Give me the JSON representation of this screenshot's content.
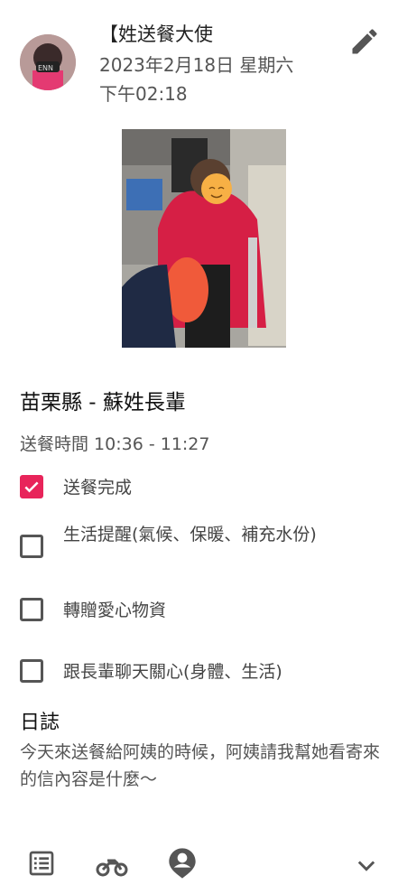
{
  "header": {
    "title": "【姓送餐大使",
    "date": "2023年2月18日 星期六",
    "time": "下午02:18"
  },
  "record": {
    "place": "苗栗縣 - 蘇姓長輩",
    "delivery_time": "送餐時間 10:36 - 11:27"
  },
  "tasks": [
    {
      "label": "送餐完成",
      "checked": true
    },
    {
      "label": "生活提醒(氣候、保暖、補充水份)",
      "checked": false
    },
    {
      "label": "轉贈愛心物資",
      "checked": false
    },
    {
      "label": "跟長輩聊天關心(身體、生活)",
      "checked": false
    }
  ],
  "log": {
    "title": "日誌",
    "body": "今天來送餐給阿姨的時候，阿姨請我幫她看寄來的信內容是什麼～"
  },
  "colors": {
    "accent": "#e8245a",
    "icon": "#555555"
  },
  "icons": {
    "edit": "pencil-icon",
    "nav": [
      "list-icon",
      "motorcycle-icon",
      "location-person-icon",
      "chevron-down-icon"
    ]
  }
}
